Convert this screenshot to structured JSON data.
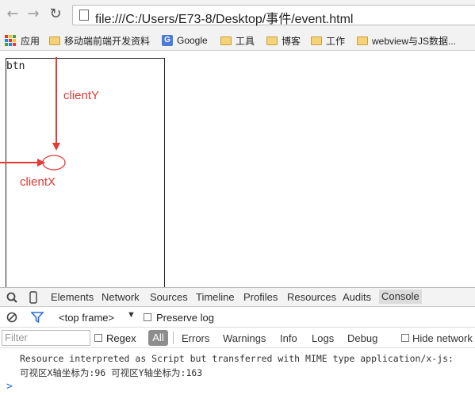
{
  "browser": {
    "url": "file:///C:/Users/E73-8/Desktop/事件/event.html"
  },
  "bookmarks": [
    {
      "label": "应用",
      "icon": "apps-grid-icon"
    },
    {
      "label": "移动端前端开发资料",
      "icon": "folder-icon"
    },
    {
      "label": "Google",
      "icon": "google-icon"
    },
    {
      "label": "工具",
      "icon": "folder-icon"
    },
    {
      "label": "博客",
      "icon": "folder-icon"
    },
    {
      "label": "工作",
      "icon": "folder-icon"
    },
    {
      "label": "webview与JS数据...",
      "icon": "folder-icon"
    }
  ],
  "page": {
    "button_label": "btn",
    "annotation_client_y": "clientY",
    "annotation_client_x": "clientX",
    "annotation_color": "#e53935"
  },
  "devtools": {
    "tabs": [
      "Elements",
      "Network",
      "Sources",
      "Timeline",
      "Profiles",
      "Resources",
      "Audits",
      "Console"
    ],
    "active_tab": "Console",
    "frame_selector": "<top frame>",
    "preserve_log_label": "Preserve log",
    "filter_placeholder": "Filter",
    "regex_label": "Regex",
    "all_label": "All",
    "levels": [
      "Errors",
      "Warnings",
      "Info",
      "Logs",
      "Debug"
    ],
    "hide_network_label": "Hide network",
    "messages": [
      "Resource interpreted as Script but transferred with MIME type application/x-js:",
      "可视区X轴坐标为:96 可视区Y轴坐标为:163"
    ],
    "prompt": ">"
  }
}
